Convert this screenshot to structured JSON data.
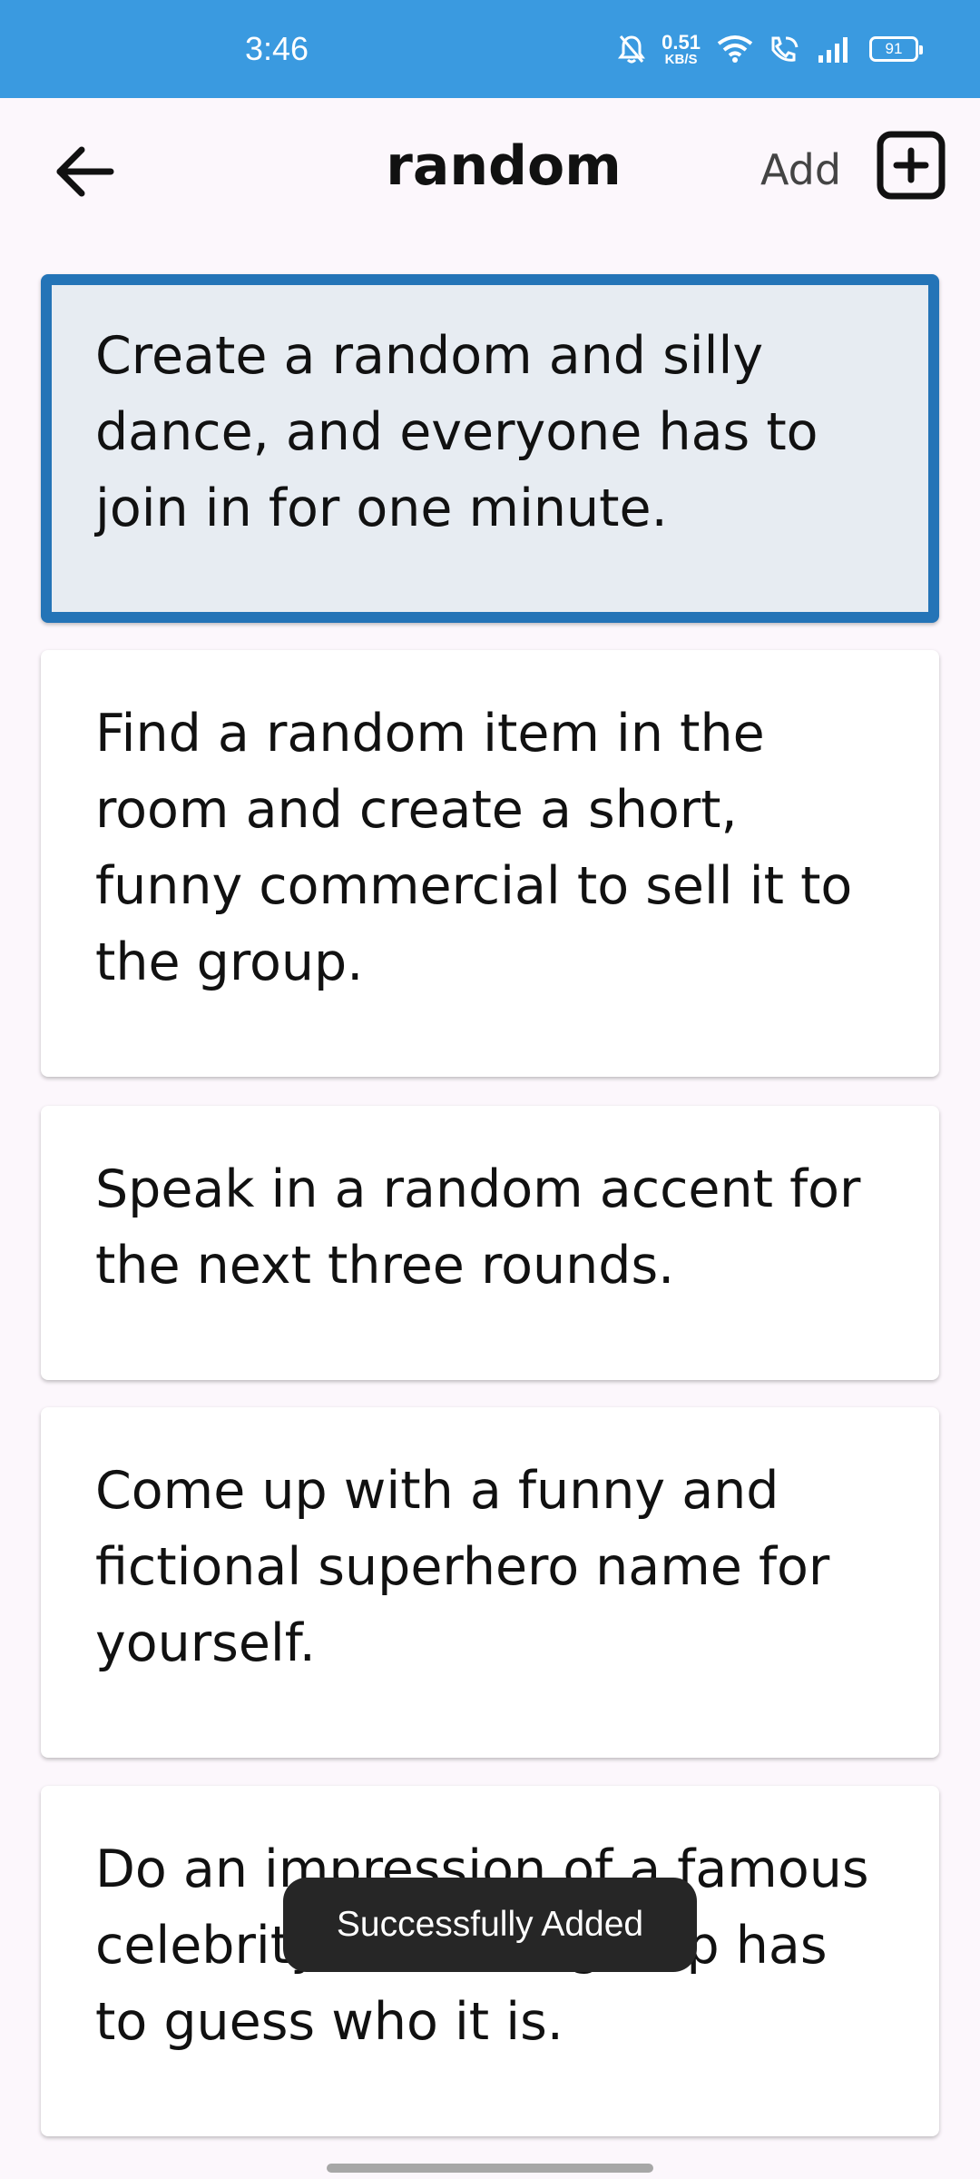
{
  "status_bar": {
    "time": "3:46",
    "net_speed": "0.51",
    "net_unit": "KB/S",
    "battery": "91",
    "icons": [
      "bell-off-icon",
      "wifi-icon",
      "wifi-calling-icon",
      "signal-icon",
      "battery-icon"
    ]
  },
  "app_bar": {
    "title": "random",
    "add_label": "Add",
    "back_icon": "arrow-left-icon",
    "add_icon": "plus-square-icon"
  },
  "cards": [
    {
      "text": "Create a random and silly dance, and everyone has to join in for one minute.",
      "selected": true
    },
    {
      "text": "Find a random item in the room and create a short, funny commercial to sell it to the group.",
      "selected": false
    },
    {
      "text": "Speak in a random accent for the next three rounds.",
      "selected": false
    },
    {
      "text": "Come up with a funny and fictional superhero name for yourself.",
      "selected": false
    },
    {
      "text": "Do an impression of a famous celebrity, and the group has to guess who it is.",
      "selected": false
    }
  ],
  "toast": {
    "text": "Successfully Added"
  },
  "colors": {
    "status_bar": "#3a9ae0",
    "selected_border": "#2474b7",
    "selected_bg": "#e7ecf2",
    "background": "#fcf7fc"
  }
}
